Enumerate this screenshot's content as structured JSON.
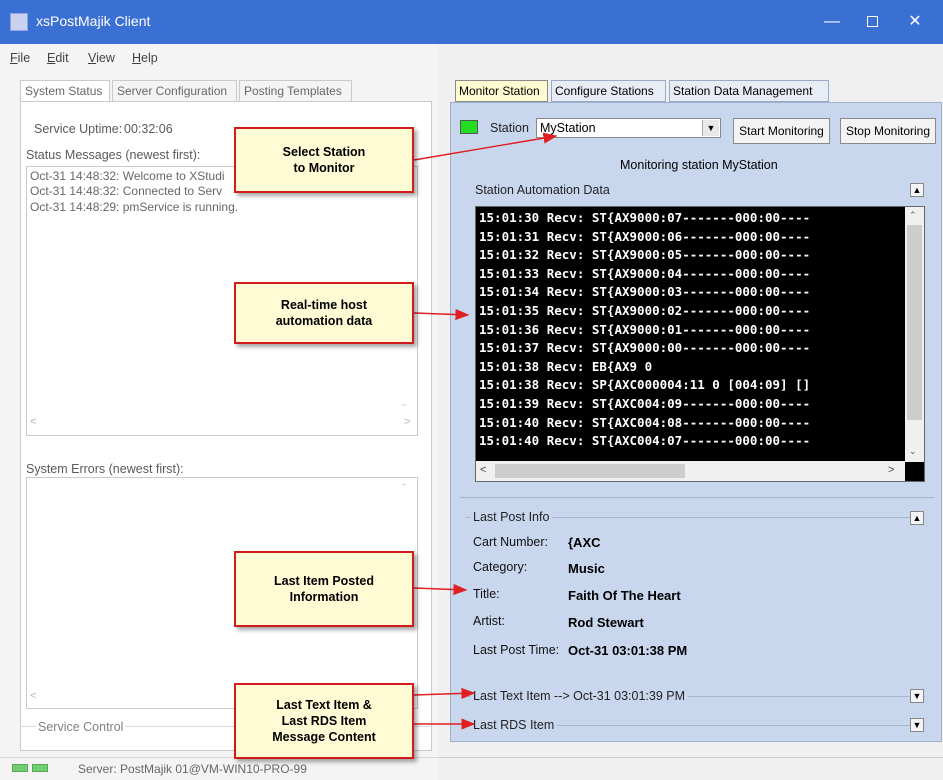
{
  "window": {
    "title": "xsPostMajik Client"
  },
  "menu": {
    "file": {
      "underline": "F",
      "rest": "ile"
    },
    "edit": {
      "underline": "E",
      "rest": "dit"
    },
    "view": {
      "underline": "V",
      "rest": "iew"
    },
    "help": {
      "underline": "H",
      "rest": "elp"
    }
  },
  "left": {
    "tabs": [
      "System Status",
      "Server Configuration",
      "Posting Templates"
    ],
    "uptime_label": "Service Uptime:",
    "uptime_value": "00:32:06",
    "status_label": "Status Messages (newest first):",
    "status_messages": [
      "Oct-31 14:48:32: Welcome to XStudi",
      "Oct-31 14:48:32: Connected to Serv",
      "Oct-31 14:48:29: pmService is running."
    ],
    "errors_label": "System Errors (newest first):",
    "service_control": "Service Control"
  },
  "right": {
    "tabs": [
      "Monitor Station",
      "Configure Stations",
      "Station Data Management"
    ],
    "status_color": "#22dd22",
    "station_label": "Station",
    "station_value": "MyStation",
    "start_button": "Start Monitoring",
    "stop_button": "Stop Monitoring",
    "monitoring_text": "Monitoring station MyStation",
    "automation_header": "Station Automation Data",
    "console_lines": [
      "15:01:30 Recv: ST{AX9000:07-------000:00----",
      "15:01:31 Recv: ST{AX9000:06-------000:00----",
      "15:01:32 Recv: ST{AX9000:05-------000:00----",
      "15:01:33 Recv: ST{AX9000:04-------000:00----",
      "15:01:34 Recv: ST{AX9000:03-------000:00----",
      "15:01:35 Recv: ST{AX9000:02-------000:00----",
      "15:01:36 Recv: ST{AX9000:01-------000:00----",
      "15:01:37 Recv: ST{AX9000:00-------000:00----",
      "15:01:38 Recv: EB{AX9 0",
      "15:01:38 Recv: SP{AXC000004:11 0 [004:09] []",
      "15:01:39 Recv: ST{AXC004:09-------000:00----",
      "15:01:40 Recv: ST{AXC004:08-------000:00----",
      "15:01:40 Recv: ST{AXC004:07-------000:00----"
    ],
    "last_post_header": "Last Post Info",
    "post": {
      "cart_label": "Cart Number:",
      "cart_value": "{AXC",
      "category_label": "Category:",
      "category_value": "Music",
      "title_label": "Title:",
      "title_value": "Faith Of The Heart",
      "artist_label": "Artist:",
      "artist_value": "Rod Stewart",
      "time_label": "Last Post Time:",
      "time_value": "Oct-31 03:01:38 PM"
    },
    "last_text_item": "Last Text Item --> Oct-31 03:01:39 PM",
    "last_rds_item": "Last RDS Item"
  },
  "callouts": {
    "select_station": [
      "Select Station",
      "to Monitor"
    ],
    "realtime": [
      "Real-time host",
      "automation data"
    ],
    "last_item": [
      "Last Item Posted",
      "Information"
    ],
    "last_text": [
      "Last Text Item &",
      "Last RDS Item",
      "Message Content"
    ]
  },
  "statusbar": {
    "server": "Server: PostMajik 01@VM-WIN10-PRO-99"
  },
  "colors": {
    "callout_border": "#d21b1b",
    "callout_fill": "#fffbd4",
    "arrow": "#e02020"
  }
}
